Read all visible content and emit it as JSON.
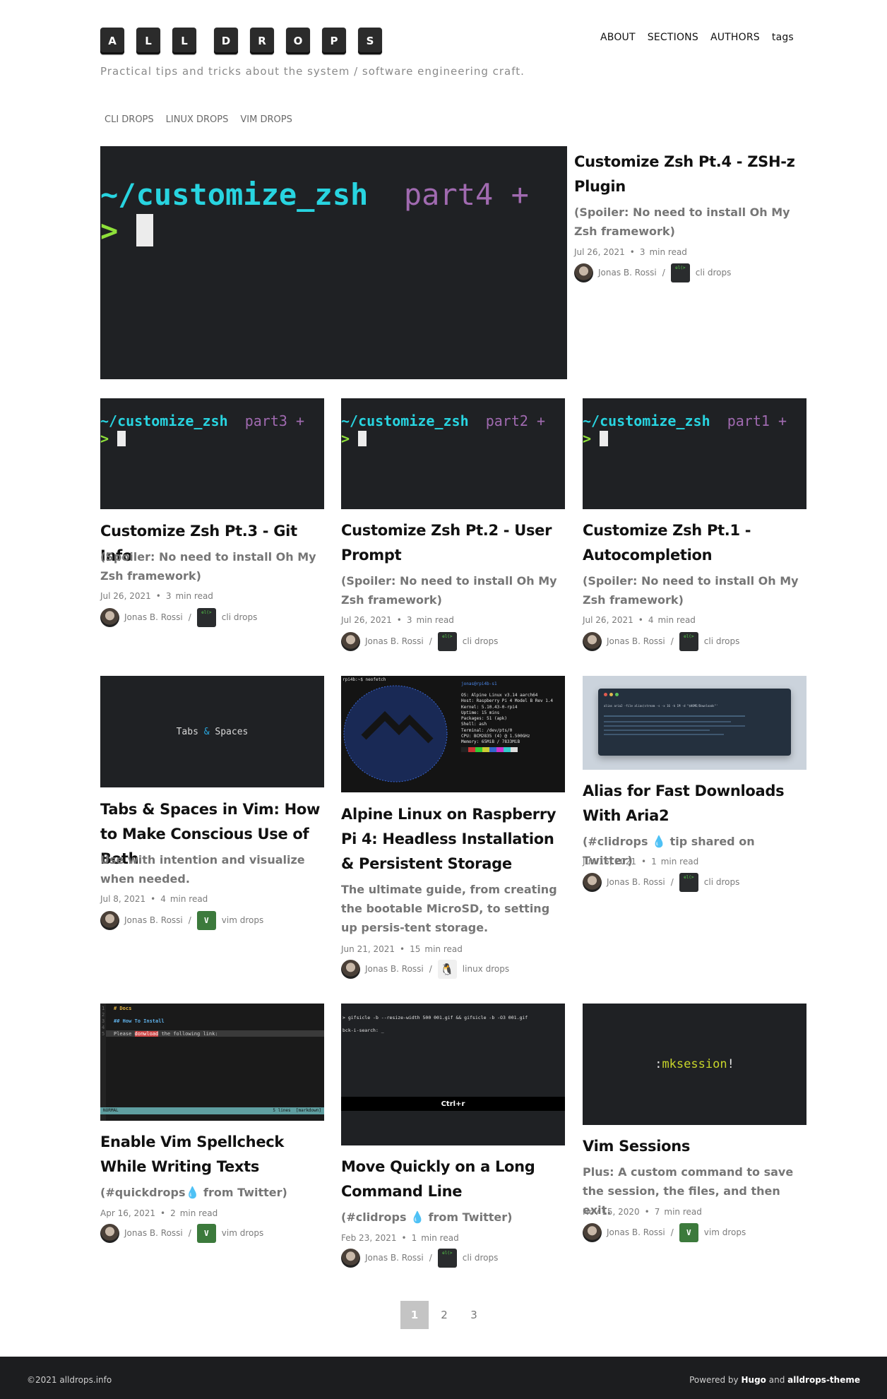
{
  "header": {
    "logo_keys": [
      "A",
      "L",
      "L",
      "D",
      "R",
      "O",
      "P",
      "S"
    ],
    "tagline": "Practical tips and tricks about the system / software engineering craft.",
    "nav": [
      "ABOUT",
      "SECTIONS",
      "AUTHORS",
      "tags"
    ],
    "subnav": [
      "CLI DROPS",
      "LINUX DROPS",
      "VIM DROPS"
    ]
  },
  "featured": {
    "thumb": {
      "dir": "~/customize_zsh",
      "part": "part4 +",
      "prompt": ">"
    },
    "title": "Customize Zsh Pt.4 - ZSH-z Plugin",
    "subtitle": "(Spoiler: No need to install Oh My Zsh framework)",
    "date": "Jul 26, 2021",
    "read_num": "3",
    "read_label": "min read",
    "author": "Jonas B. Rossi",
    "section": "cli drops"
  },
  "posts": [
    {
      "thumb": {
        "dir": "~/customize_zsh",
        "part": "part3 +",
        "prompt": ">"
      },
      "title": "Customize Zsh Pt.3 - Git Info",
      "subtitle": "(Spoiler: No need to install Oh My Zsh framework)",
      "date": "Jul 26, 2021",
      "read_num": "3",
      "read_label": "min read",
      "author": "Jonas B. Rossi",
      "section": "cli drops"
    },
    {
      "thumb": {
        "dir": "~/customize_zsh",
        "part": "part2 +",
        "prompt": ">"
      },
      "title": "Customize Zsh Pt.2 - User Prompt",
      "subtitle": "(Spoiler: No need to install Oh My Zsh framework)",
      "date": "Jul 26, 2021",
      "read_num": "3",
      "read_label": "min read",
      "author": "Jonas B. Rossi",
      "section": "cli drops"
    },
    {
      "thumb": {
        "dir": "~/customize_zsh",
        "part": "part1 +",
        "prompt": ">"
      },
      "title": "Customize Zsh Pt.1 - Autocompletion",
      "subtitle": "(Spoiler: No need to install Oh My Zsh framework)",
      "date": "Jul 26, 2021",
      "read_num": "4",
      "read_label": "min read",
      "author": "Jonas B. Rossi",
      "section": "cli drops"
    },
    {
      "thumb": {
        "text_a": "Tabs",
        "amp": "&",
        "text_b": "Spaces"
      },
      "title": "Tabs & Spaces in Vim: How to Make Conscious Use of Both",
      "subtitle": "Use with intention and visualize when needed.",
      "date": "Jul 8, 2021",
      "read_num": "4",
      "read_label": "min read",
      "author": "Jonas B. Rossi",
      "section": "vim drops"
    },
    {
      "thumb": {
        "cmd": "rpi4b:~$ neofetch",
        "host": "jonas@rpi4b-s1",
        "info": [
          "OS: Alpine Linux v3.14 aarch64",
          "Host: Raspberry Pi 4 Model B Rev 1.4",
          "Kernel: 5.10.43-0-rpi4",
          "Uptime: 15 mins",
          "Packages: 51 (apk)",
          "Shell: ash",
          "Terminal: /dev/pts/0",
          "CPU: BCM2835 (4) @ 1.500GHz",
          "Memory: 65MiB / 7833MiB"
        ]
      },
      "title": "Alpine Linux on Raspberry Pi 4: Headless Installation & Persistent Storage",
      "subtitle": "The ultimate guide, from creating the bootable MicroSD, to setting up persis-tent storage.",
      "date": "Jun 21, 2021",
      "read_num": "15",
      "read_label": "min read",
      "author": "Jonas B. Rossi",
      "section": "linux drops"
    },
    {
      "thumb": {
        "line": "alias aria2 -file alias(stream -s -x 16 -k 1M -d \"$HOME/Downloads\"'"
      },
      "title": "Alias for Fast Downloads With Aria2",
      "subtitle_a": "(#clidrops",
      "subtitle_b": "tip shared on Twitter)",
      "date": "Jun 15, 2021",
      "read_num": "1",
      "read_label": "min read",
      "author": "Jonas B. Rossi",
      "section": "cli drops"
    },
    {
      "thumb": {
        "l1": "# Docs",
        "l2": "## How To Install",
        "l3_a": "Please ",
        "l3_b": "donwload",
        "l3_c": " the following link:",
        "status_mode": "NORMAL",
        "status_right": "5 lines  [markdown]"
      },
      "title": "Enable Vim Spellcheck While Writing Texts",
      "subtitle_a": "(#quickdrops",
      "subtitle_b": "from Twitter)",
      "date": "Apr 16, 2021",
      "read_num": "2",
      "read_label": "min read",
      "author": "Jonas B. Rossi",
      "section": "vim drops"
    },
    {
      "thumb": {
        "cmd": "> gifsicle -b --resize-width 500 001.gif && gifsicle -b -O3 001.gif",
        "search": "bck-i-search: _",
        "keys": "Ctrl+r"
      },
      "title": "Move Quickly on a Long Command Line",
      "subtitle_a": "(#clidrops",
      "subtitle_b": "from Twitter)",
      "date": "Feb 23, 2021",
      "read_num": "1",
      "read_label": "min read",
      "author": "Jonas B. Rossi",
      "section": "cli drops"
    },
    {
      "thumb": {
        "colon": ":",
        "word": "mksession",
        "bang": "!"
      },
      "title": "Vim Sessions",
      "subtitle": "Plus: A custom command to save the session, the files, and then exit.",
      "date": "Nov 15, 2020",
      "read_num": "7",
      "read_label": "min read",
      "author": "Jonas B. Rossi",
      "section": "vim drops"
    }
  ],
  "pagination": [
    "1",
    "2",
    "3"
  ],
  "footer": {
    "copyright": "©2021 alldrops.info",
    "powered": "Powered by",
    "hugo": "Hugo",
    "and": "and",
    "theme": "alldrops-theme"
  },
  "colors": {
    "terminal_bg": "#1f2124",
    "cyan": "#28d4e0",
    "purple": "#a06ab0",
    "green": "#8ee03a"
  }
}
